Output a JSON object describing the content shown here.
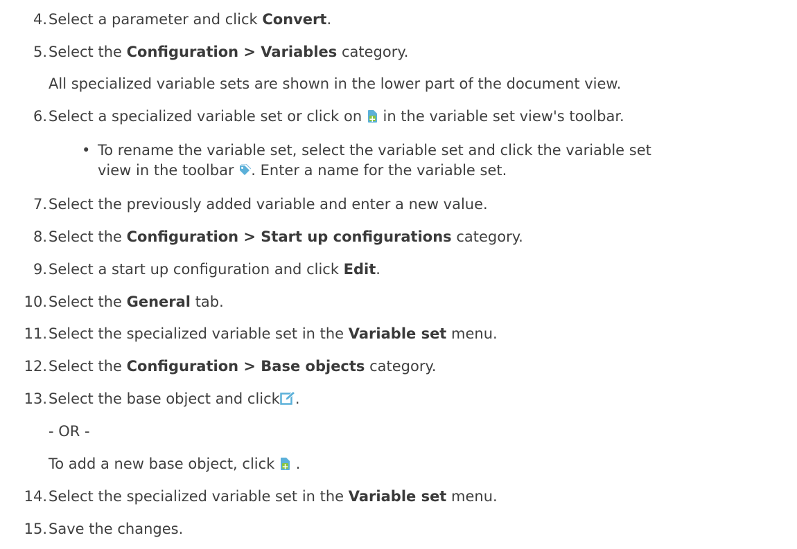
{
  "steps": [
    {
      "num": "4.",
      "pre": "Select a parameter and click ",
      "bold": "Convert",
      "post": "."
    },
    {
      "num": "5.",
      "pre": "Select the ",
      "bold": "Configuration > Variables",
      "post": " category."
    },
    {
      "note": "All specialized variable sets are shown in the lower part of the document view."
    },
    {
      "num": "6.",
      "pre": "Select a specialized variable set or click on ",
      "post": " in the variable set view's toolbar."
    },
    {
      "bullet": "•",
      "line1": "To rename the variable set, select the variable set and click the variable set",
      "line2_pre": "view in the toolbar ",
      "line2_post": ". Enter a name for the variable set."
    },
    {
      "num": "7.",
      "text": "Select the previously added variable and enter a new value."
    },
    {
      "num": "8.",
      "pre": "Select the ",
      "bold": "Configuration > Start up configurations",
      "post": " category."
    },
    {
      "num": "9.",
      "pre": "Select a start up configuration and click ",
      "bold": "Edit",
      "post": "."
    },
    {
      "num": "10.",
      "pre": "Select the ",
      "bold": "General",
      "post": " tab."
    },
    {
      "num": "11.",
      "pre": "Select the specialized variable set in the ",
      "bold": "Variable set",
      "post": " menu."
    },
    {
      "num": "12.",
      "pre": "Select the ",
      "bold": "Configuration > Base objects",
      "post": " category."
    },
    {
      "num": "13.",
      "pre": "Select the base object and click",
      "post": "."
    },
    {
      "or": "- OR -"
    },
    {
      "pre": "To add a new base object, click ",
      "post": " ."
    },
    {
      "num": "14.",
      "pre": "Select the specialized variable set in the ",
      "bold": "Variable set",
      "post": " menu."
    },
    {
      "num": "15.",
      "text": "Save the changes."
    }
  ],
  "icons": {
    "add": "add-document-icon",
    "rename": "tag-rename-icon",
    "edit": "edit-icon"
  },
  "colors": {
    "text": "#3f3f3f",
    "icon_blue": "#5bb0d9",
    "icon_green": "#8ac53f"
  }
}
